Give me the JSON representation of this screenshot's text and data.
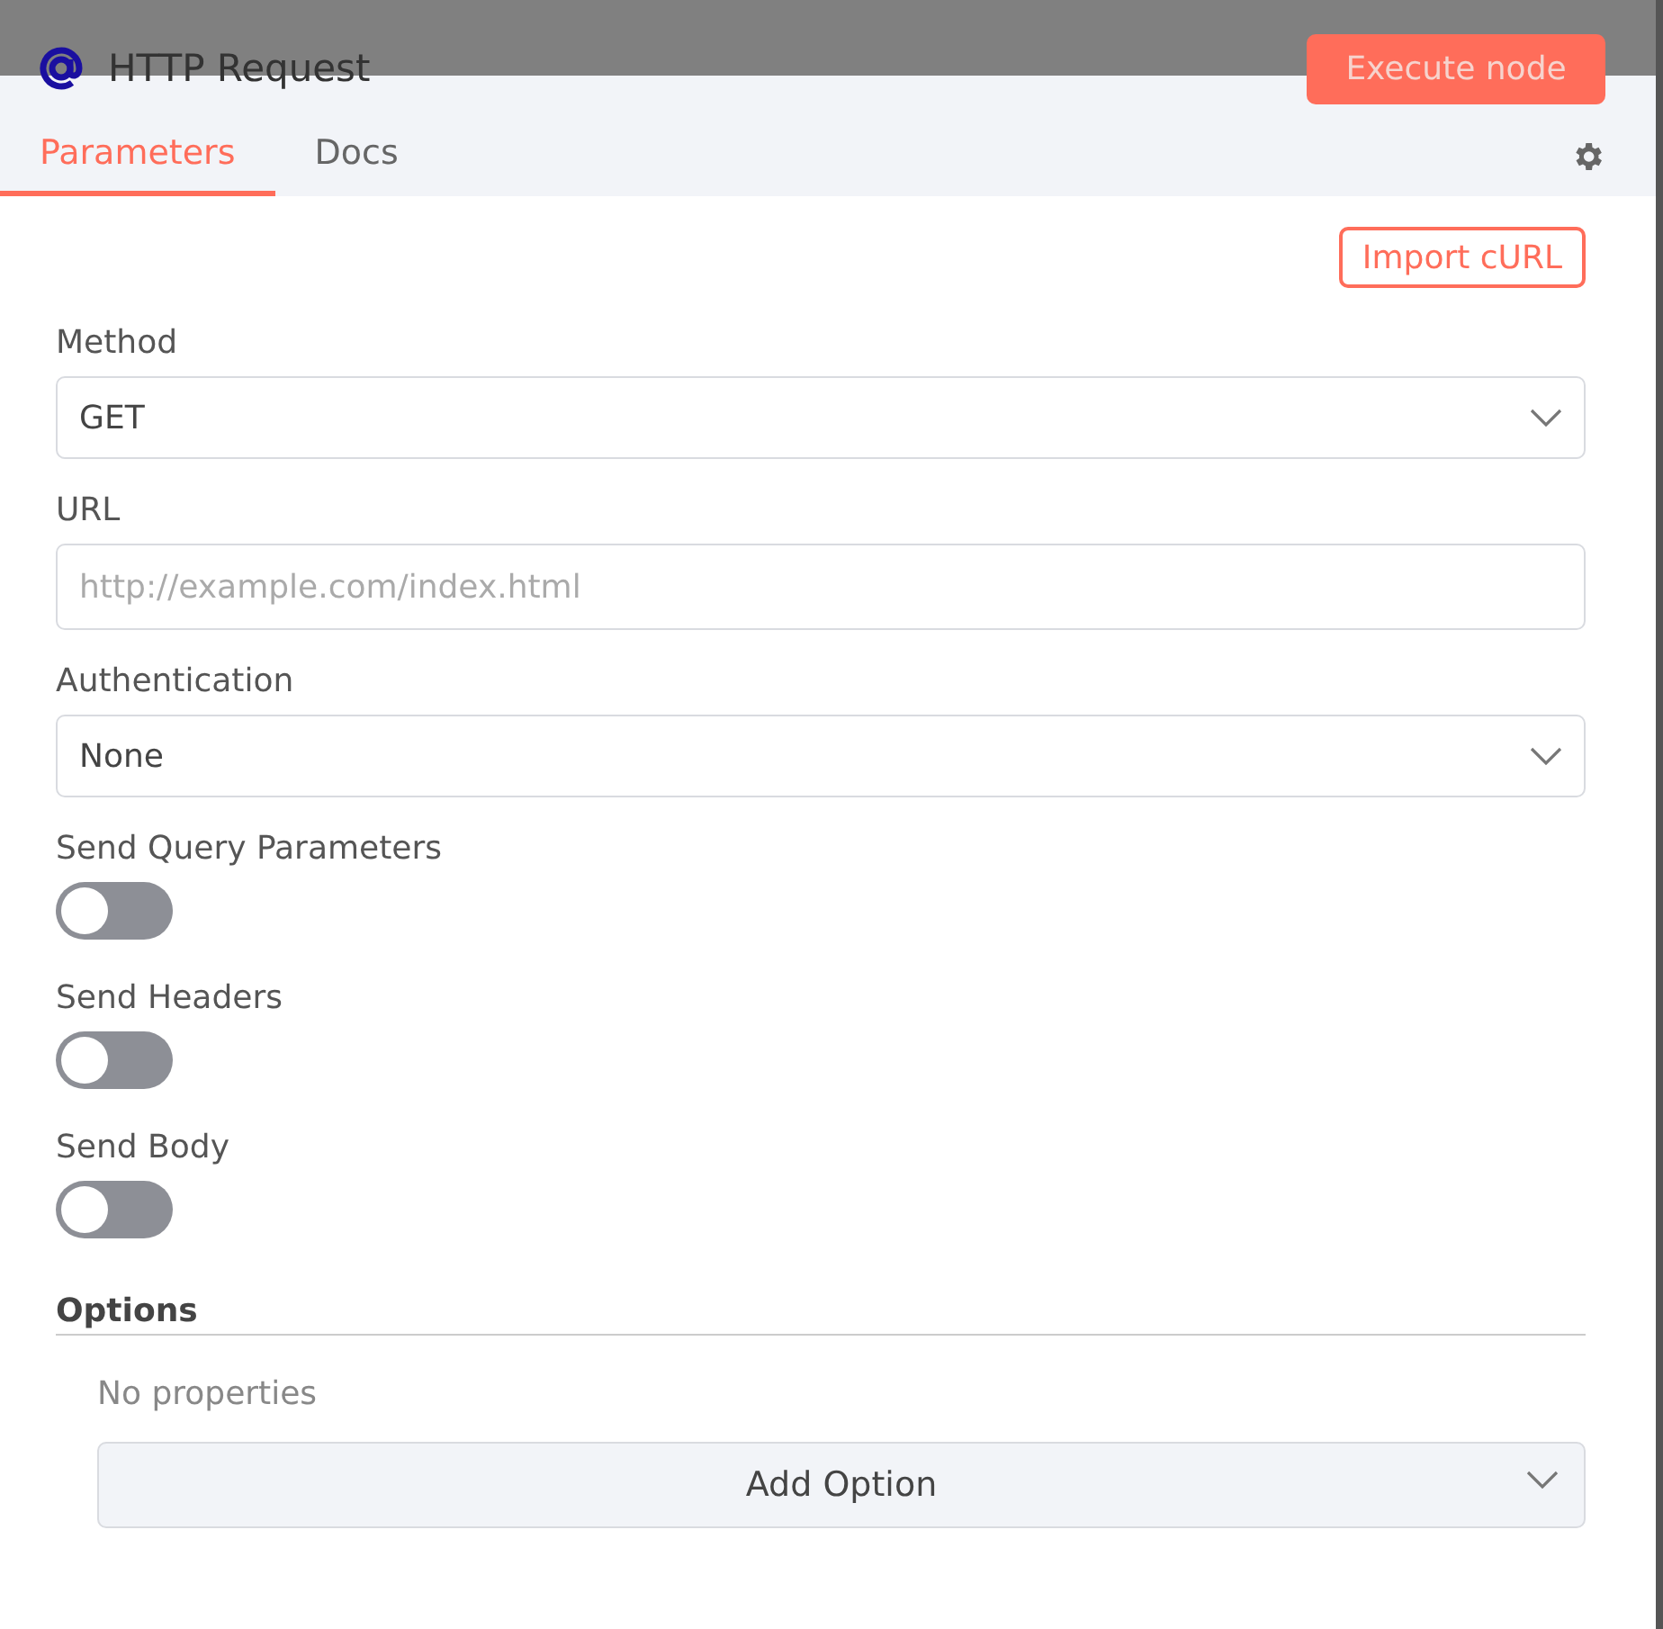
{
  "header": {
    "title": "HTTP Request",
    "execute_button": "Execute node"
  },
  "tabs": [
    {
      "label": "Parameters",
      "selected": true
    },
    {
      "label": "Docs",
      "selected": false
    }
  ],
  "import_button": "Import cURL",
  "fields": [
    {
      "kind": "select",
      "label": "Method",
      "value": "GET"
    },
    {
      "kind": "input",
      "label": "URL",
      "placeholder": "http://example.com/index.html"
    },
    {
      "kind": "select",
      "label": "Authentication",
      "value": "None"
    },
    {
      "kind": "toggle",
      "label": "Send Query Parameters",
      "on": false
    },
    {
      "kind": "toggle",
      "label": "Send Headers",
      "on": false
    },
    {
      "kind": "toggle",
      "label": "Send Body",
      "on": false
    }
  ],
  "options": {
    "title": "Options",
    "empty_text": "No properties",
    "add_button": "Add Option"
  }
}
